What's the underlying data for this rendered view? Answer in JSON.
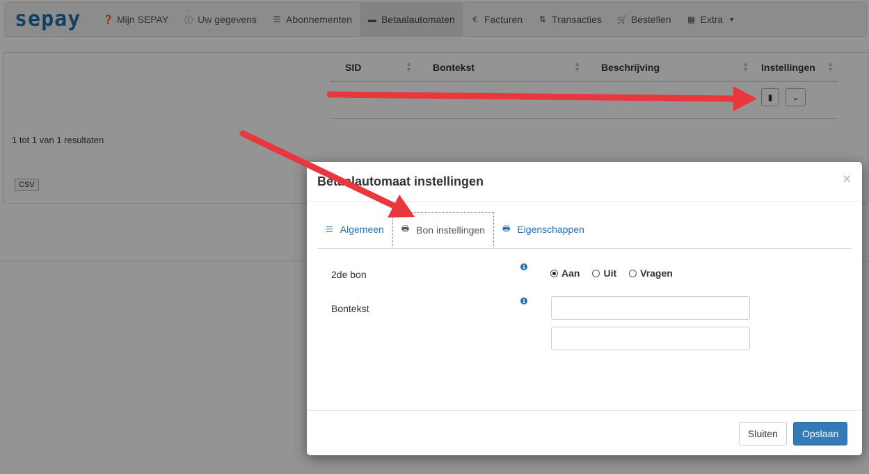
{
  "brand": {
    "logo_text": "sepay",
    "color": "#1f6fa8"
  },
  "nav": {
    "items": [
      {
        "label": "Mijn SEPAY",
        "icon": "question-circle-icon"
      },
      {
        "label": "Uw gegevens",
        "icon": "info-circle-icon"
      },
      {
        "label": "Abonnementen",
        "icon": "list-icon"
      },
      {
        "label": "Betaalautomaten",
        "icon": "credit-card-icon",
        "active": true
      },
      {
        "label": "Facturen",
        "icon": "euro-icon"
      },
      {
        "label": "Transacties",
        "icon": "sort-arrows-icon"
      },
      {
        "label": "Bestellen",
        "icon": "cart-icon"
      },
      {
        "label": "Extra",
        "icon": "grid-icon",
        "dropdown": true
      }
    ]
  },
  "table": {
    "columns": [
      "SID",
      "Bontekst",
      "Beschrijving",
      "Instellingen"
    ]
  },
  "results_text": "1 tot 1 van 1 resultaten",
  "csv_label": "CSV",
  "modal": {
    "title": "Betaalautomaat instellingen",
    "close": "×",
    "tabs": [
      {
        "label": "Algemeen",
        "icon": "list-icon"
      },
      {
        "label": "Bon instellingen",
        "icon": "printer-icon",
        "active": true
      },
      {
        "label": "Eigenschappen",
        "icon": "printer-icon"
      }
    ],
    "fields": {
      "second_receipt": {
        "label": "2de bon",
        "info": "i",
        "options": [
          "Aan",
          "Uit",
          "Vragen"
        ],
        "selected": "Aan"
      },
      "receipt_text": {
        "label": "Bontekst",
        "info": "i",
        "line1": "",
        "line2": ""
      }
    },
    "buttons": {
      "close": "Sluiten",
      "save": "Opslaan"
    }
  },
  "colors": {
    "primary": "#337ab7",
    "link": "#2a6fb0",
    "annotation_arrow": "#e8383d"
  }
}
